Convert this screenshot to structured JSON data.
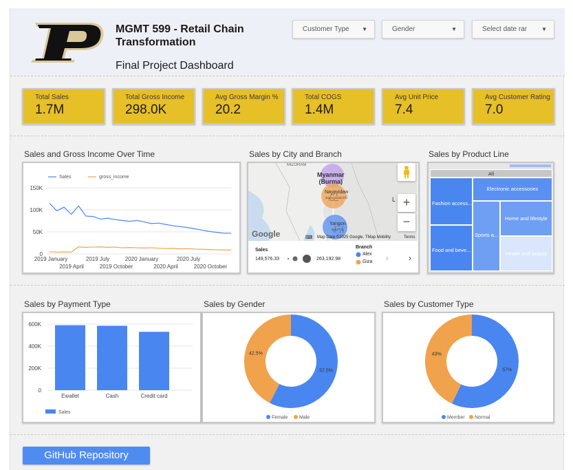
{
  "header": {
    "title": "MGMT 599 - Retail Chain Transformation",
    "subtitle": "Final Project Dashboard",
    "logo_letter": "P",
    "filters": [
      {
        "label": "Customer Type"
      },
      {
        "label": "Gender"
      },
      {
        "label": "Select date rar"
      }
    ]
  },
  "kpis": [
    {
      "label": "Total Sales",
      "value": "1.7M"
    },
    {
      "label": "Total Gross Income",
      "value": "298.0K"
    },
    {
      "label": "Avg Gross Margin %",
      "value": "20.2"
    },
    {
      "label": "Total COGS",
      "value": "1.4M"
    },
    {
      "label": "Avg Unit Price",
      "value": "7.4"
    },
    {
      "label": "Avg Customer Rating",
      "value": "7.0"
    }
  ],
  "titles": {
    "line": "Sales and Gross Income Over Time",
    "map": "Sales by City and Branch",
    "treemap": "Sales by Product Line",
    "payment": "Sales by Payment Type",
    "gender": "Sales by Gender",
    "customer": "Sales by Customer Type"
  },
  "colors": {
    "blue": "#4a86f0",
    "orange": "#f0a24c",
    "gold": "#e7bf26",
    "purple": "#c3a6ea"
  },
  "map": {
    "country_label": "Myanmar\n(Burma)",
    "city1": "Naypyidaw\nနေပြည်တော်",
    "city2": "Yangon\nရန်ကုန်",
    "top_label": "MIZORAM",
    "right_label": "L",
    "google": "Google",
    "keyboard": "⌨",
    "attribution": "Map Data ©2025 Google, TMap Mobility",
    "terms": "Terms",
    "size_title": "Sales",
    "size_min": "149,576.33",
    "size_max": "263,192.98",
    "branch_title": "Branch",
    "branch_1": "Alex",
    "branch_2": "Giza"
  },
  "github": {
    "label": "GitHub Repository"
  },
  "chart_data": [
    {
      "type": "line",
      "title": "Sales and Gross Income Over Time",
      "series": [
        {
          "name": "Sales",
          "color": "#4a86f0",
          "values": [
            115000,
            98000,
            106000,
            90000,
            109000,
            86000,
            85000,
            79000,
            81000,
            78000,
            76000,
            74000,
            76000,
            73000,
            69000,
            70000,
            67000,
            64000,
            62000,
            60000,
            57000,
            54000,
            51000,
            49000,
            47000,
            47000
          ]
        },
        {
          "name": "gross_income",
          "color": "#f0a24c",
          "values": [
            5000,
            4000,
            4500,
            4300,
            16000,
            15000,
            15500,
            16000,
            15000,
            15500,
            14000,
            14500,
            14000,
            13500,
            14000,
            13000,
            12000,
            12500,
            11500,
            12000,
            11000,
            10500,
            10000,
            9500,
            9000,
            9000
          ]
        }
      ],
      "x_ticks_top": [
        "2019 January",
        "2019 July",
        "2020 January",
        "2020 July"
      ],
      "x_ticks_bottom": [
        "2019 April",
        "2019 October",
        "2020 April",
        "2020 October"
      ],
      "y_ticks": [
        "150K",
        "100K",
        "50K",
        "0"
      ],
      "ylim": [
        0,
        150000
      ]
    },
    {
      "type": "bar",
      "title": "Sales by Payment Type",
      "categories": [
        "Ewallet",
        "Cash",
        "Credit card"
      ],
      "series": [
        {
          "name": "Sales",
          "color": "#4a86f0",
          "values": [
            590000,
            585000,
            530000
          ]
        }
      ],
      "y_ticks": [
        "600K",
        "400K",
        "200K",
        "0"
      ],
      "ylim": [
        0,
        600000
      ]
    },
    {
      "type": "pie",
      "title": "Sales by Gender",
      "slices": [
        {
          "name": "Female",
          "value": 57.5,
          "label": "57.5%",
          "color": "#4a86f0"
        },
        {
          "name": "Male",
          "value": 42.5,
          "label": "42.5%",
          "color": "#f0a24c"
        }
      ]
    },
    {
      "type": "pie",
      "title": "Sales by Customer Type",
      "slices": [
        {
          "name": "Member",
          "value": 57,
          "label": "57%",
          "color": "#4a86f0"
        },
        {
          "name": "Normal",
          "value": 43,
          "label": "43%",
          "color": "#f0a24c"
        }
      ]
    },
    {
      "type": "treemap",
      "title": "Sales by Product Line",
      "root_label": "All",
      "items": [
        {
          "name": "Fashion access...",
          "color": "#4a86f0"
        },
        {
          "name": "Food and beve...",
          "color": "#4a86f0"
        },
        {
          "name": "Sports a...",
          "color": "#6e9ff3"
        },
        {
          "name": "Electronic accessories",
          "color": "#5a90f2"
        },
        {
          "name": "Home and lifestyle",
          "color": "#6e9ff3"
        },
        {
          "name": "Health and beauty",
          "color": "#d9e6fc"
        }
      ]
    }
  ]
}
